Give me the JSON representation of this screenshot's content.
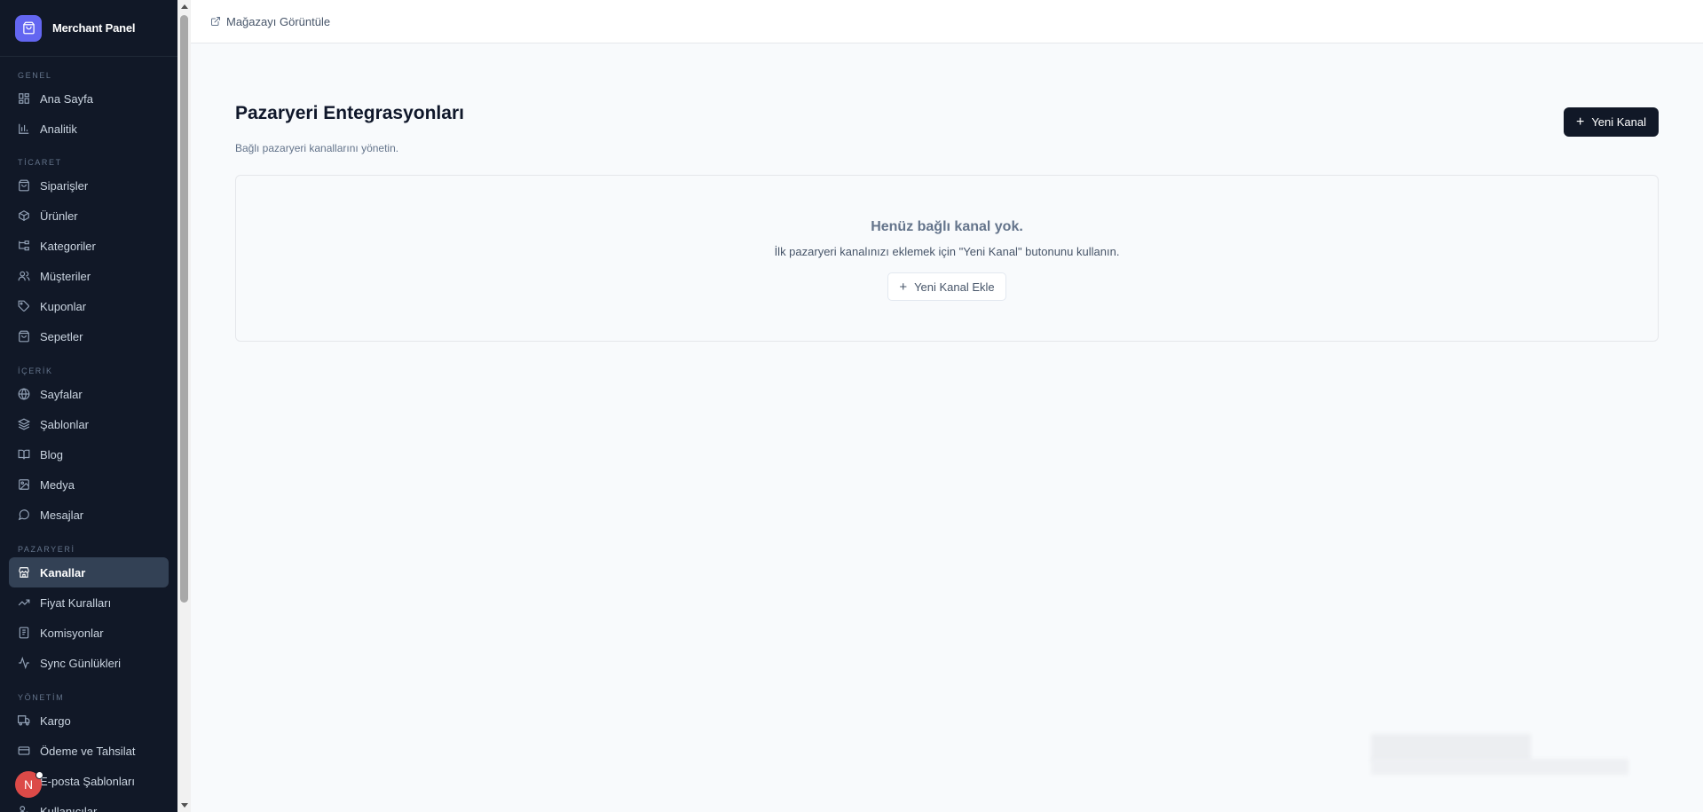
{
  "brand": {
    "name": "Merchant Panel"
  },
  "topbar": {
    "view_store": "Mağazayı Görüntüle"
  },
  "sidebar": {
    "sections": [
      {
        "title": "GENEL",
        "items": [
          {
            "label": "Ana Sayfa",
            "icon": "dashboard-icon"
          },
          {
            "label": "Analitik",
            "icon": "bar-chart-icon"
          }
        ]
      },
      {
        "title": "TİCARET",
        "items": [
          {
            "label": "Siparişler",
            "icon": "shopping-bag-icon"
          },
          {
            "label": "Ürünler",
            "icon": "package-icon"
          },
          {
            "label": "Kategoriler",
            "icon": "tree-icon"
          },
          {
            "label": "Müşteriler",
            "icon": "users-icon"
          },
          {
            "label": "Kuponlar",
            "icon": "tag-icon"
          },
          {
            "label": "Sepetler",
            "icon": "basket-icon"
          }
        ]
      },
      {
        "title": "İÇERİK",
        "items": [
          {
            "label": "Sayfalar",
            "icon": "globe-icon"
          },
          {
            "label": "Şablonlar",
            "icon": "layers-icon"
          },
          {
            "label": "Blog",
            "icon": "book-icon"
          },
          {
            "label": "Medya",
            "icon": "image-icon"
          },
          {
            "label": "Mesajlar",
            "icon": "message-icon"
          }
        ]
      },
      {
        "title": "PAZARYERİ",
        "items": [
          {
            "label": "Kanallar",
            "icon": "store-icon",
            "active": true
          },
          {
            "label": "Fiyat Kuralları",
            "icon": "trending-icon"
          },
          {
            "label": "Komisyonlar",
            "icon": "receipt-icon"
          },
          {
            "label": "Sync Günlükleri",
            "icon": "activity-icon"
          }
        ]
      },
      {
        "title": "YÖNETİM",
        "items": [
          {
            "label": "Kargo",
            "icon": "truck-icon"
          },
          {
            "label": "Ödeme ve Tahsilat",
            "icon": "credit-card-icon"
          },
          {
            "label": "E-posta Şablonları",
            "icon": "mail-icon"
          },
          {
            "label": "Kullanıcılar",
            "icon": "user-cog-icon"
          }
        ]
      }
    ]
  },
  "user": {
    "initial": "N"
  },
  "main": {
    "title": "Pazaryeri Entegrasyonları",
    "subtitle": "Bağlı pazaryeri kanallarını yönetin.",
    "new_button": "Yeni Kanal",
    "empty": {
      "title": "Henüz bağlı kanal yok.",
      "description": "İlk pazaryeri kanalınızı eklemek için \"Yeni Kanal\" butonunu kullanın.",
      "add_button": "Yeni Kanal Ekle"
    }
  },
  "colors": {
    "sidebar_bg": "#111827",
    "accent": "#6366f1",
    "active_bg": "#334155",
    "avatar": "#dc4a48"
  }
}
